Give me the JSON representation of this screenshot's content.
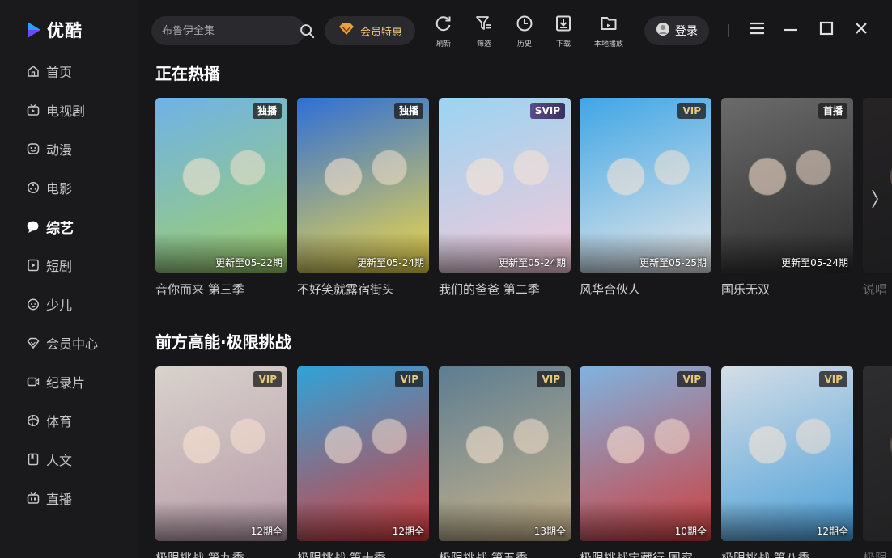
{
  "app": {
    "name": "优酷"
  },
  "sidebar": {
    "items": [
      {
        "label": "首页",
        "icon": "home-icon"
      },
      {
        "label": "电视剧",
        "icon": "tv-icon"
      },
      {
        "label": "动漫",
        "icon": "anime-face-icon"
      },
      {
        "label": "电影",
        "icon": "film-reel-icon"
      },
      {
        "label": "综艺",
        "icon": "speech-bubble-icon",
        "active": true
      },
      {
        "label": "短剧",
        "icon": "play-square-icon"
      },
      {
        "label": "少儿",
        "icon": "kid-face-icon"
      },
      {
        "label": "会员中心",
        "icon": "diamond-icon"
      },
      {
        "label": "纪录片",
        "icon": "camera-icon"
      },
      {
        "label": "体育",
        "icon": "ball-icon"
      },
      {
        "label": "人文",
        "icon": "book-icon"
      },
      {
        "label": "直播",
        "icon": "live-tv-icon"
      }
    ]
  },
  "search": {
    "placeholder": "布鲁伊全集"
  },
  "vip": {
    "label": "会员特惠"
  },
  "toolbar": {
    "refresh": "刷新",
    "filter": "筛选",
    "history": "历史",
    "download": "下载",
    "local": "本地播放"
  },
  "login": {
    "label": "登录"
  },
  "sections": [
    {
      "title": "正在热播",
      "cards": [
        {
          "title": "音你而来 第三季",
          "badge": "独播",
          "update": "更新至05-22期",
          "colors": [
            "#6fb2e8",
            "#9fd06a"
          ]
        },
        {
          "title": "不好笑就露宿街头",
          "badge": "独播",
          "update": "更新至05-24期",
          "colors": [
            "#2f6fd6",
            "#f0d84a"
          ]
        },
        {
          "title": "我们的爸爸 第二季",
          "badge": "SVIP",
          "update": "更新至05-24期",
          "colors": [
            "#9ad4f2",
            "#f6c8d8"
          ]
        },
        {
          "title": "风华合伙人",
          "badge": "VIP",
          "update": "更新至05-25期",
          "colors": [
            "#3fa6e6",
            "#e8e8e8"
          ]
        },
        {
          "title": "国乐无双",
          "badge": "首播",
          "update": "更新至05-24期",
          "colors": [
            "#6b6b6b",
            "#2c2c2c"
          ]
        },
        {
          "title": "说唱",
          "badge": "",
          "update": "",
          "colors": [
            "#3a3434",
            "#1e1e1e"
          ]
        }
      ]
    },
    {
      "title": "前方高能·极限挑战",
      "cards": [
        {
          "title": "极限挑战 第九季",
          "badge": "VIP",
          "update": "12期全",
          "colors": [
            "#d8d2cc",
            "#b79aa8"
          ]
        },
        {
          "title": "极限挑战 第十季",
          "badge": "VIP",
          "update": "12期全",
          "colors": [
            "#2fa3d8",
            "#d83c3c"
          ]
        },
        {
          "title": "极限挑战 第五季",
          "badge": "VIP",
          "update": "13期全",
          "colors": [
            "#5d7d92",
            "#c9b48a"
          ]
        },
        {
          "title": "极限挑战宝藏行 国家",
          "badge": "VIP",
          "update": "10期全",
          "colors": [
            "#7fb3df",
            "#cf3f3f"
          ]
        },
        {
          "title": "极限挑战 第八季",
          "badge": "VIP",
          "update": "12期全",
          "colors": [
            "#d4dde6",
            "#4a9fd8"
          ]
        },
        {
          "title": "极限",
          "badge": "",
          "update": "",
          "colors": [
            "#4a4a4a",
            "#2a2a2a"
          ]
        }
      ]
    }
  ]
}
